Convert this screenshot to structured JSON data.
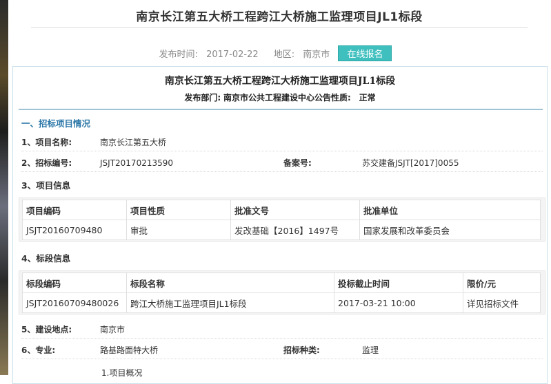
{
  "page_title": "南京长江第五大桥工程跨江大桥施工监理项目JL1标段",
  "meta": {
    "publish_label": "发布时间:",
    "publish_date": "2017-02-22",
    "region_label": "地区:",
    "region": "南京市",
    "apply_button": "在线报名"
  },
  "doc": {
    "title": "南京长江第五大桥工程跨江大桥施工监理项目JL1标段",
    "sub_label1": "发布部门:",
    "sub_value1": "南京市公共工程建设中心",
    "sub_label2": "公告性质:",
    "sub_value2": "正常"
  },
  "section1": "一、招标项目情况",
  "fields": {
    "name_label": "1、项目名称:",
    "name_value": "南京长江第五大桥",
    "bid_no_label": "2、招标编号:",
    "bid_no_value": "JSJT20170213590",
    "record_label": "备案号:",
    "record_value": "苏交建备JSJT[2017]0055",
    "info_label": "3、项目信息",
    "lot_label": "4、标段信息",
    "location_label": "5、建设地点:",
    "location_value": "南京市",
    "major_label": "6、专业:",
    "major_value": "路基路面特大桥",
    "type_label": "招标种类:",
    "type_value": "监理"
  },
  "project_table": {
    "headers": [
      "项目编码",
      "项目性质",
      "批准文号",
      "批准单位"
    ],
    "row": [
      "JSJT20160709480",
      "审批",
      "发改基础【2016】1497号",
      "国家发展和改革委员会"
    ]
  },
  "lot_table": {
    "headers": [
      "标段编码",
      "标段名称",
      "投标截止时间",
      "限价/元"
    ],
    "row": [
      "JSJT20160709480026",
      "跨江大桥施工监理项目JL1标段",
      "2017-03-21 10:00",
      "详见招标文件"
    ]
  },
  "footnote": "1.项目概况"
}
